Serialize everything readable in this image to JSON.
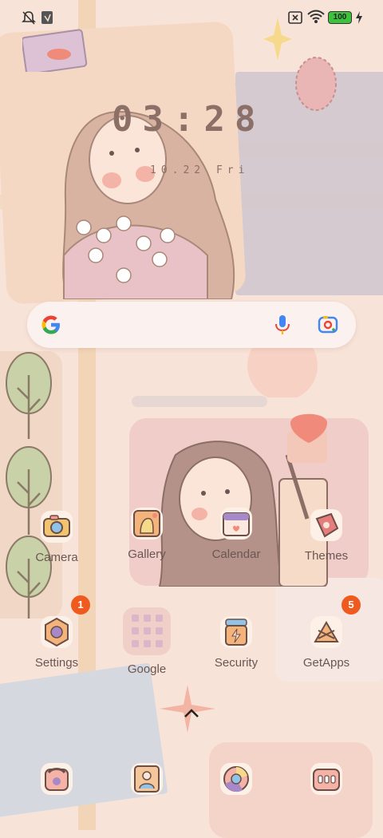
{
  "status_bar": {
    "left_icons": [
      "mute-icon",
      "notification-icon"
    ],
    "right_icons": [
      "no-sim-icon",
      "wifi-icon",
      "battery-icon",
      "charging-icon"
    ],
    "battery_level": "100",
    "battery_color": "#3cc23c"
  },
  "clock_widget": {
    "time": "03:28",
    "date": "10.22 Fri"
  },
  "search_bar": {
    "logo": "google-g-icon",
    "mic_icon": "microphone-icon",
    "lens_icon": "google-lens-icon"
  },
  "apps_row1": [
    {
      "label": "Camera",
      "icon": "camera-icon"
    },
    {
      "label": "Gallery",
      "icon": "gallery-icon"
    },
    {
      "label": "Calendar",
      "icon": "calendar-icon"
    },
    {
      "label": "Themes",
      "icon": "themes-icon"
    }
  ],
  "apps_row2": [
    {
      "label": "Settings",
      "icon": "settings-icon",
      "badge": "1"
    },
    {
      "label": "Google",
      "icon": "google-folder-icon"
    },
    {
      "label": "Security",
      "icon": "security-icon"
    },
    {
      "label": "GetApps",
      "icon": "getapps-icon",
      "badge": "5"
    }
  ],
  "dock": [
    {
      "icon": "phone-icon"
    },
    {
      "icon": "contacts-icon"
    },
    {
      "icon": "browser-icon"
    },
    {
      "icon": "messages-icon"
    }
  ],
  "app_drawer_handle": "chevron-up-icon",
  "colors": {
    "background": "#f8e3d8",
    "badge": "#ef5a1f",
    "text": "#6b5752",
    "clock": "#8c6f66"
  }
}
